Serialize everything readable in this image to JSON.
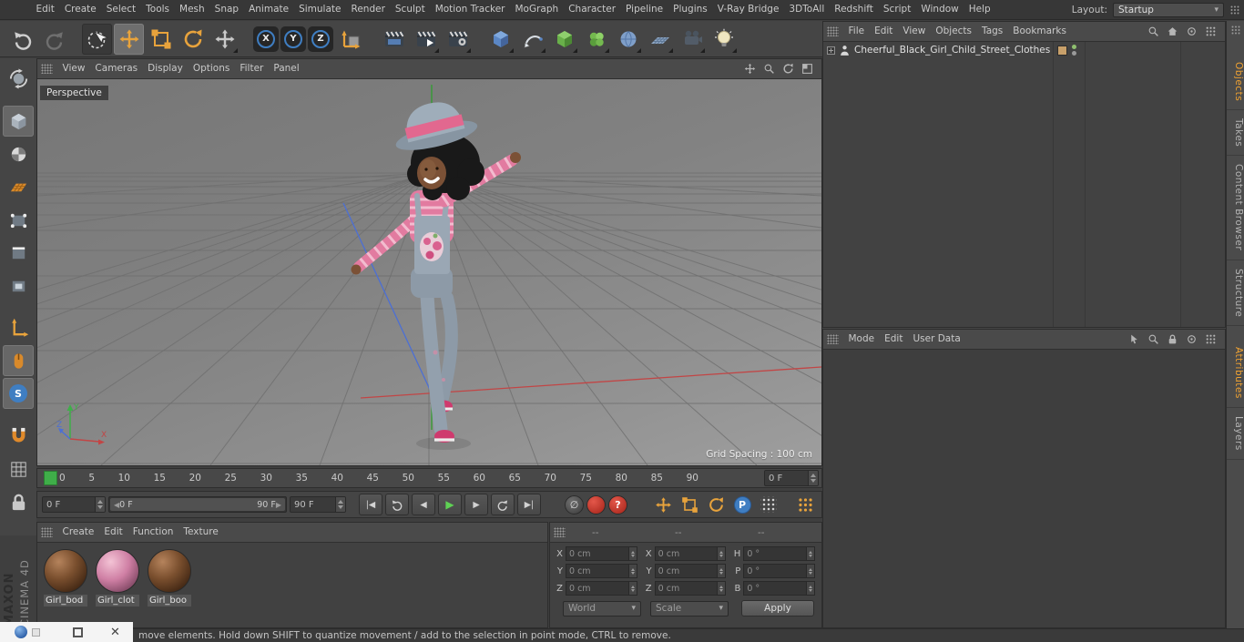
{
  "colors": {
    "accent_orange": "#E8A33C",
    "play_green": "#5FD254",
    "record_red": "#C8372D",
    "frame_marker_green": "#3FAE49",
    "axis_x_red": "#C24545",
    "axis_y_green": "#2F9E2F",
    "axis_z_blue": "#4C6FD4",
    "layer_swatch_tan": "#C8A06A",
    "active_tab_orange": "#F0A232"
  },
  "icons": {
    "dropd own_note": "",
    "dropdown_arrow": "▾",
    "go_to_start": "|◀",
    "previous_frame": "◀",
    "play": "▶",
    "next_frame": "▶",
    "go_to_end": "▶|",
    "record_off": "∅",
    "question": "?",
    "close": "✕",
    "slider_left_cap": "◀",
    "slider_right_cap": "▶",
    "snap_letter": "S",
    "parameter_letter": "P",
    "axis_locks": [
      "X",
      "Y",
      "Z"
    ]
  },
  "menu_bar": {
    "items": [
      "Edit",
      "Create",
      "Select",
      "Tools",
      "Mesh",
      "Snap",
      "Animate",
      "Simulate",
      "Render",
      "Sculpt",
      "Motion Tracker",
      "MoGraph",
      "Character",
      "Pipeline",
      "Plugins",
      "V-Ray Bridge",
      "3DToAll",
      "Redshift",
      "Script",
      "Window",
      "Help"
    ],
    "layout_label": "Layout:",
    "layout_value": "Startup"
  },
  "viewport": {
    "menus": [
      "View",
      "Cameras",
      "Display",
      "Options",
      "Filter",
      "Panel"
    ],
    "view_label": "Perspective",
    "grid_spacing": "Grid Spacing : 100 cm",
    "axis_labels": {
      "x": "X",
      "y": "Y",
      "z": "Z"
    }
  },
  "timeline": {
    "ticks": [
      "0",
      "5",
      "10",
      "15",
      "20",
      "25",
      "30",
      "35",
      "40",
      "45",
      "50",
      "55",
      "60",
      "65",
      "70",
      "75",
      "80",
      "85",
      "90"
    ],
    "ruler_frame": "0 F",
    "current_frame": "0 F",
    "range_start": "0 F",
    "range_end": "90 F",
    "end_frame": "90 F"
  },
  "materials": {
    "menus": [
      "Create",
      "Edit",
      "Function",
      "Texture"
    ],
    "items": [
      {
        "name": "Girl_bod",
        "variant": "brown"
      },
      {
        "name": "Girl_clot",
        "variant": "pink"
      },
      {
        "name": "Girl_boo",
        "variant": "brown"
      }
    ]
  },
  "coordinates": {
    "headers": [
      "--",
      "--",
      "--"
    ],
    "position": {
      "labels": [
        "X",
        "Y",
        "Z"
      ],
      "values": [
        "0 cm",
        "0 cm",
        "0 cm"
      ]
    },
    "size": {
      "labels": [
        "X",
        "Y",
        "Z"
      ],
      "values": [
        "0 cm",
        "0 cm",
        "0 cm"
      ]
    },
    "rotation": {
      "labels": [
        "H",
        "P",
        "B"
      ],
      "values": [
        "0 °",
        "0 °",
        "0 °"
      ]
    },
    "mode_dropdown": "World",
    "scale_dropdown": "Scale",
    "apply_button": "Apply"
  },
  "object_manager": {
    "menus": [
      "File",
      "Edit",
      "View",
      "Objects",
      "Tags",
      "Bookmarks"
    ],
    "objects": [
      {
        "name": "Cheerful_Black_Girl_Child_Street_Clothes"
      }
    ],
    "tabs": [
      {
        "label": "Objects",
        "active": true
      },
      {
        "label": "Takes"
      },
      {
        "label": "Content Browser"
      },
      {
        "label": "Structure"
      }
    ]
  },
  "attribute_manager": {
    "menus": [
      "Mode",
      "Edit",
      "User Data"
    ],
    "tabs": [
      {
        "label": "Attributes",
        "active": true
      },
      {
        "label": "Layers"
      }
    ]
  },
  "status_bar": {
    "text": "move elements. Hold down SHIFT to quantize movement / add to the selection in point mode, CTRL to remove."
  },
  "branding": {
    "maxon": "MAXON",
    "cinema": "CINEMA 4D"
  }
}
